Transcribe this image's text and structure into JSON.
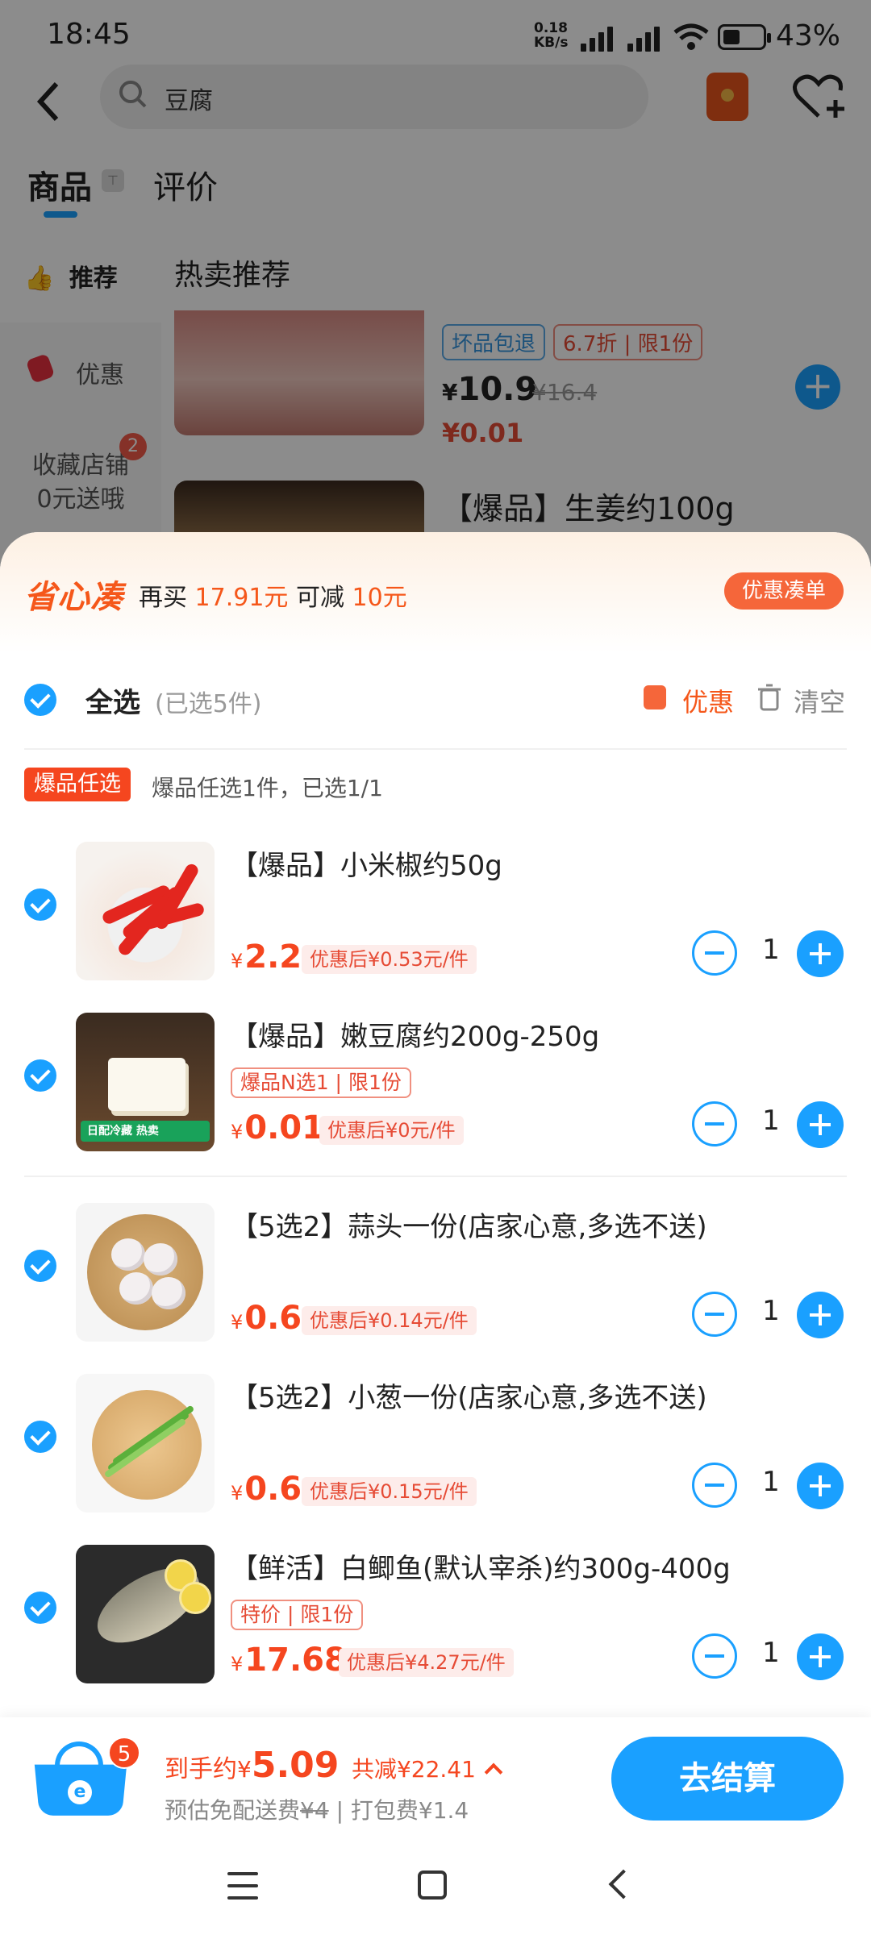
{
  "status_bar": {
    "time": "18:45",
    "net_speed": "0.18",
    "net_unit": "KB/s",
    "battery": "43%"
  },
  "header": {
    "search_text": "豆腐"
  },
  "tabs": [
    {
      "label": "商品"
    },
    {
      "label": "评价"
    }
  ],
  "left_nav": {
    "items": [
      {
        "label": "推荐"
      },
      {
        "label": "优惠"
      },
      {
        "label": "收藏店铺\n0元送哦",
        "badge": "2"
      }
    ]
  },
  "background_list": {
    "section_title": "热卖推荐",
    "product1": {
      "tags": [
        "坏品包退",
        "6.7折",
        "限1份"
      ],
      "price_symbol": "¥",
      "price": "10.9",
      "old_price": "¥16.4",
      "sub_price": "¥0.01"
    },
    "product2": {
      "name": "【爆品】生姜约100g"
    }
  },
  "sheet": {
    "logo": "省心凑",
    "promo_prefix": "再买",
    "promo_amount": "17.91元",
    "promo_mid": "可减",
    "promo_discount": "10元",
    "deal_button": "优惠凑单",
    "select_all": "全选",
    "selected_count": "(已选5件)",
    "coupon_label": "优惠",
    "clear_label": "清空",
    "group_tag": "爆品任选",
    "group_desc": "爆品任选1件，已选1/1",
    "items": [
      {
        "name": "【爆品】小米椒约50g",
        "tags": [],
        "currency": "¥",
        "price": "2.2",
        "discount": "优惠后¥0.53元/件",
        "qty": "1"
      },
      {
        "name": "【爆品】嫩豆腐约200g-250g",
        "tags": [
          "爆品N选1",
          "限1份"
        ],
        "currency": "¥",
        "price": "0.01",
        "discount": "优惠后¥0元/件",
        "qty": "1",
        "thumb_banner": "日配冷藏  热卖"
      },
      {
        "name": "【5选2】蒜头一份(店家心意,多选不送)",
        "tags": [],
        "currency": "¥",
        "price": "0.6",
        "discount": "优惠后¥0.14元/件",
        "qty": "1"
      },
      {
        "name": "【5选2】小葱一份(店家心意,多选不送)",
        "tags": [],
        "currency": "¥",
        "price": "0.6",
        "discount": "优惠后¥0.15元/件",
        "qty": "1"
      },
      {
        "name": "【鲜活】白鲫鱼(默认宰杀)约300g-400g",
        "tags": [
          "特价",
          "限1份"
        ],
        "currency": "¥",
        "price": "17.68",
        "discount": "优惠后¥4.27元/件",
        "qty": "1"
      }
    ]
  },
  "footer": {
    "basket_badge": "5",
    "total_label": "到手约",
    "total_currency": "¥",
    "total_value": "5.09",
    "saving": "共减¥22.41",
    "ship_prefix": "预估免配送费",
    "ship_old": "¥4",
    "pack_fee": "| 打包费¥1.4",
    "checkout": "去结算"
  },
  "colors": {
    "accent_blue": "#1aa0ff",
    "accent_orange": "#f5461f"
  }
}
